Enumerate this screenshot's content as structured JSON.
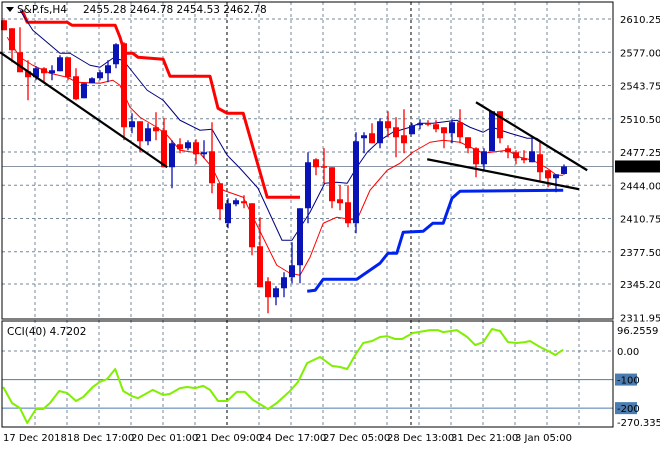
{
  "header": {
    "symbol": "S&P.fs,H4",
    "ohlc": "2455.28 2464.78 2454.53 2462.78"
  },
  "colors": {
    "bull": "#0a14b4",
    "bear": "#ff0000",
    "ma_fast": "#ff0000",
    "ma_slow": "#000080",
    "stop_upper": "#ff0000",
    "stop_lower": "#0022ee",
    "cci": "#80f000",
    "grid": "#778899",
    "level": "#4a7cb0"
  },
  "chart_data": [
    {
      "type": "candlestick",
      "title": "S&P.fs,H4",
      "ylim": [
        2311.95,
        2629.25
      ],
      "y_ticks": [
        "2610.25",
        "2577.00",
        "2543.75",
        "2510.50",
        "2477.25",
        "2444.00",
        "2410.75",
        "2377.50",
        "2345.20",
        "2311.95"
      ],
      "current_price": "2462.78",
      "x_labels": [
        "17 Dec 2018",
        "18 Dec 17:00",
        "20 Dec 01:00",
        "21 Dec 09:00",
        "24 Dec 17:00",
        "27 Dec 05:00",
        "28 Dec 13:00",
        "31 Dec 21:00",
        "3 Jan 05:00"
      ],
      "candles_ohlc": [
        [
          2609,
          2609,
          2599,
          2599
        ],
        [
          2601,
          2601,
          2567,
          2579
        ],
        [
          2577,
          2602,
          2557,
          2557
        ],
        [
          2558,
          2569,
          2529,
          2552
        ],
        [
          2552,
          2563,
          2549,
          2561
        ],
        [
          2561,
          2562,
          2547,
          2556
        ],
        [
          2556,
          2564,
          2549,
          2559
        ],
        [
          2558,
          2574,
          2558,
          2572
        ],
        [
          2572,
          2572,
          2549,
          2552
        ],
        [
          2553,
          2561,
          2529,
          2530
        ],
        [
          2531,
          2546,
          2531,
          2546
        ],
        [
          2546,
          2552,
          2546,
          2551
        ],
        [
          2551,
          2559,
          2549,
          2557
        ],
        [
          2556,
          2569,
          2547,
          2564
        ],
        [
          2565,
          2586,
          2561,
          2585
        ],
        [
          2586,
          2587,
          2489,
          2502
        ],
        [
          2502,
          2516,
          2496,
          2508
        ],
        [
          2508,
          2508,
          2477,
          2488
        ],
        [
          2488,
          2506,
          2484,
          2501
        ],
        [
          2502,
          2517,
          2489,
          2498
        ],
        [
          2499,
          2511,
          2462,
          2462
        ],
        [
          2462,
          2489,
          2441,
          2486
        ],
        [
          2485,
          2491,
          2476,
          2480
        ],
        [
          2481,
          2489,
          2479,
          2487
        ],
        [
          2487,
          2490,
          2465,
          2475
        ],
        [
          2475,
          2489,
          2471,
          2477
        ],
        [
          2478,
          2507,
          2436,
          2446
        ],
        [
          2446,
          2446,
          2409,
          2420
        ],
        [
          2406,
          2431,
          2401,
          2426
        ],
        [
          2425,
          2431,
          2423,
          2429
        ],
        [
          2428,
          2434,
          2421,
          2426
        ],
        [
          2426,
          2426,
          2374,
          2382
        ],
        [
          2383,
          2412,
          2342,
          2342
        ],
        [
          2348,
          2352,
          2316,
          2332
        ],
        [
          2332,
          2343,
          2324,
          2341
        ],
        [
          2341,
          2357,
          2332,
          2352
        ],
        [
          2352,
          2387,
          2346,
          2364
        ],
        [
          2364,
          2421,
          2346,
          2421
        ],
        [
          2421,
          2477,
          2406,
          2467
        ],
        [
          2470,
          2471,
          2454,
          2462
        ],
        [
          2463,
          2481,
          2446,
          2462
        ],
        [
          2462,
          2462,
          2421,
          2428
        ],
        [
          2430,
          2444,
          2419,
          2426
        ],
        [
          2427,
          2444,
          2402,
          2406
        ],
        [
          2406,
          2497,
          2396,
          2488
        ],
        [
          2491,
          2497,
          2476,
          2494
        ],
        [
          2496,
          2506,
          2486,
          2486
        ],
        [
          2486,
          2511,
          2481,
          2508
        ],
        [
          2508,
          2518,
          2492,
          2501
        ],
        [
          2502,
          2512,
          2472,
          2492
        ],
        [
          2494,
          2520,
          2476,
          2486
        ],
        [
          2495,
          2506,
          2495,
          2504
        ],
        [
          2504,
          2510,
          2500,
          2506
        ],
        [
          2506,
          2509,
          2503,
          2505
        ],
        [
          2505,
          2509,
          2497,
          2500
        ],
        [
          2502,
          2502,
          2481,
          2496
        ],
        [
          2496,
          2510,
          2486,
          2507
        ],
        [
          2507,
          2520,
          2486,
          2492
        ],
        [
          2492,
          2492,
          2476,
          2481
        ],
        [
          2481,
          2482,
          2452,
          2465
        ],
        [
          2465,
          2481,
          2459,
          2478
        ],
        [
          2478,
          2518,
          2478,
          2518
        ],
        [
          2518,
          2518,
          2486,
          2491
        ],
        [
          2481,
          2484,
          2471,
          2477
        ],
        [
          2477,
          2479,
          2465,
          2471
        ],
        [
          2471,
          2479,
          2466,
          2469
        ],
        [
          2467,
          2492,
          2467,
          2478
        ],
        [
          2475,
          2487,
          2447,
          2457
        ],
        [
          2459,
          2459,
          2442,
          2451
        ],
        [
          2451,
          2455,
          2437,
          2455
        ],
        [
          2455.28,
          2464.78,
          2454.53,
          2462.78
        ]
      ],
      "overlays": {
        "ma_slow": [
          [
            2,
            2619
          ],
          [
            3.6,
            2599
          ],
          [
            7,
            2576
          ],
          [
            8.25,
            2576
          ],
          [
            10.75,
            2564
          ],
          [
            12,
            2562
          ],
          [
            13.6,
            2571
          ],
          [
            14.9,
            2569
          ],
          [
            17.9,
            2539
          ],
          [
            19.9,
            2529
          ],
          [
            22,
            2509
          ],
          [
            24.5,
            2499
          ],
          [
            26,
            2500
          ],
          [
            27.9,
            2474
          ],
          [
            29.5,
            2461
          ],
          [
            31.75,
            2441
          ],
          [
            34.75,
            2389
          ],
          [
            36,
            2389
          ],
          [
            38.25,
            2417
          ],
          [
            40.1,
            2446
          ],
          [
            41.6,
            2447
          ],
          [
            42.9,
            2446
          ],
          [
            44.1,
            2462
          ],
          [
            45.4,
            2477
          ],
          [
            47,
            2489
          ],
          [
            48.6,
            2497
          ],
          [
            50.75,
            2502
          ],
          [
            52,
            2506
          ],
          [
            53.6,
            2506
          ],
          [
            56.6,
            2509
          ],
          [
            58.25,
            2502
          ],
          [
            59.9,
            2497
          ],
          [
            61,
            2502
          ],
          [
            63.25,
            2496
          ],
          [
            65.4,
            2491
          ],
          [
            66.6,
            2491
          ],
          [
            67.9,
            2484
          ]
        ],
        "ma_fast": [
          [
            0.4,
            2592
          ],
          [
            2,
            2572
          ],
          [
            3.6,
            2564
          ],
          [
            5.75,
            2556
          ],
          [
            7.9,
            2552
          ],
          [
            9.1,
            2547
          ],
          [
            12,
            2546
          ],
          [
            13.6,
            2549
          ],
          [
            14.5,
            2544
          ],
          [
            15.75,
            2522
          ],
          [
            17,
            2512
          ],
          [
            19.1,
            2502
          ],
          [
            20.4,
            2494
          ],
          [
            22,
            2479
          ],
          [
            24.5,
            2476
          ],
          [
            26,
            2462
          ],
          [
            27.4,
            2439
          ],
          [
            29.9,
            2432
          ],
          [
            31.75,
            2402
          ],
          [
            34.1,
            2364
          ],
          [
            35.75,
            2356
          ],
          [
            37,
            2354
          ],
          [
            38.25,
            2372
          ],
          [
            39.9,
            2406
          ],
          [
            41.6,
            2412
          ],
          [
            44.1,
            2409
          ],
          [
            45.75,
            2439
          ],
          [
            47.9,
            2459
          ],
          [
            49.5,
            2466
          ],
          [
            51.1,
            2477
          ],
          [
            53.25,
            2487
          ],
          [
            54.9,
            2489
          ],
          [
            57,
            2487
          ],
          [
            58.6,
            2481
          ],
          [
            59.9,
            2476
          ],
          [
            62.9,
            2479
          ],
          [
            64.5,
            2472
          ],
          [
            66.1,
            2469
          ],
          [
            67.9,
            2461
          ],
          [
            69.1,
            2454
          ],
          [
            69.9,
            2454
          ]
        ],
        "stop_upper": [
          [
            2.25,
            2619
          ],
          [
            2.9,
            2607
          ],
          [
            7.9,
            2607
          ],
          [
            8.5,
            2604
          ],
          [
            13.9,
            2604
          ],
          [
            14.5,
            2592
          ],
          [
            15.1,
            2576
          ],
          [
            16.1,
            2576
          ],
          [
            16.75,
            2572
          ],
          [
            19.9,
            2570
          ],
          [
            20.75,
            2553
          ],
          [
            25.75,
            2553
          ],
          [
            26.75,
            2521
          ],
          [
            27.9,
            2516
          ],
          [
            29.9,
            2516
          ],
          [
            32.9,
            2432
          ],
          [
            37,
            2432
          ]
        ],
        "stop_lower": [
          [
            37.9,
            2338
          ],
          [
            38.9,
            2339
          ],
          [
            39.9,
            2350
          ],
          [
            44.1,
            2350
          ],
          [
            47,
            2366
          ],
          [
            48,
            2376
          ],
          [
            49.1,
            2376
          ],
          [
            49.9,
            2397
          ],
          [
            52.4,
            2398
          ],
          [
            53.6,
            2406
          ],
          [
            54.9,
            2406
          ],
          [
            56,
            2431
          ],
          [
            57,
            2438
          ],
          [
            69.9,
            2439
          ]
        ],
        "trendlines": [
          [
            [
              -0.5,
              2577
            ],
            [
              20.4,
              2462
            ]
          ],
          [
            [
              59,
              2527
            ],
            [
              72.9,
              2459
            ]
          ],
          [
            [
              52.9,
              2470
            ],
            [
              71.9,
              2440
            ]
          ]
        ]
      }
    },
    {
      "type": "line",
      "title": "CCI(40) 4.7202",
      "ylim": [
        -270.3353,
        96.2559
      ],
      "y_ticks": [
        "96.2559",
        "0.00",
        "-100",
        "-200",
        "-270.3353"
      ],
      "levels": [
        -100,
        -200
      ],
      "points": [
        [
          -0.1,
          -126
        ],
        [
          1,
          -182
        ],
        [
          2,
          -200
        ],
        [
          2.9,
          -252
        ],
        [
          4,
          -203
        ],
        [
          4.9,
          -203
        ],
        [
          5.75,
          -182
        ],
        [
          6.9,
          -140
        ],
        [
          7.9,
          -147
        ],
        [
          9,
          -175
        ],
        [
          9.9,
          -161
        ],
        [
          11.1,
          -126
        ],
        [
          12,
          -108
        ],
        [
          12.9,
          -98
        ],
        [
          13.9,
          -63
        ],
        [
          14.9,
          -140
        ],
        [
          16,
          -158
        ],
        [
          16.75,
          -165
        ],
        [
          17.9,
          -147
        ],
        [
          18.6,
          -136
        ],
        [
          19.9,
          -154
        ],
        [
          20.75,
          -150
        ],
        [
          22,
          -130
        ],
        [
          22.9,
          -126
        ],
        [
          23.9,
          -130
        ],
        [
          24.9,
          -122
        ],
        [
          25.75,
          -136
        ],
        [
          26.75,
          -175
        ],
        [
          27.9,
          -175
        ],
        [
          29.1,
          -143
        ],
        [
          30.1,
          -143
        ],
        [
          31.1,
          -171
        ],
        [
          32,
          -186
        ],
        [
          33,
          -203
        ],
        [
          34.1,
          -182
        ],
        [
          35.75,
          -140
        ],
        [
          36.75,
          -108
        ],
        [
          37.9,
          -42
        ],
        [
          39.5,
          -21
        ],
        [
          41,
          -52
        ],
        [
          42,
          -56
        ],
        [
          42.9,
          -63
        ],
        [
          43.9,
          -14
        ],
        [
          44.9,
          28
        ],
        [
          46,
          35
        ],
        [
          47,
          49
        ],
        [
          47.9,
          52
        ],
        [
          48.9,
          42
        ],
        [
          49.75,
          42
        ],
        [
          51.1,
          63
        ],
        [
          53.25,
          73
        ],
        [
          54.25,
          73
        ],
        [
          54.9,
          66
        ],
        [
          56.6,
          73
        ],
        [
          57.9,
          49
        ],
        [
          58.9,
          21
        ],
        [
          59.9,
          31
        ],
        [
          61,
          77
        ],
        [
          62,
          70
        ],
        [
          63,
          31
        ],
        [
          64.1,
          28
        ],
        [
          65.1,
          31
        ],
        [
          65.75,
          35
        ],
        [
          67,
          14
        ],
        [
          68.25,
          -3
        ],
        [
          68.9,
          -14
        ],
        [
          69.9,
          4.72
        ]
      ]
    }
  ]
}
